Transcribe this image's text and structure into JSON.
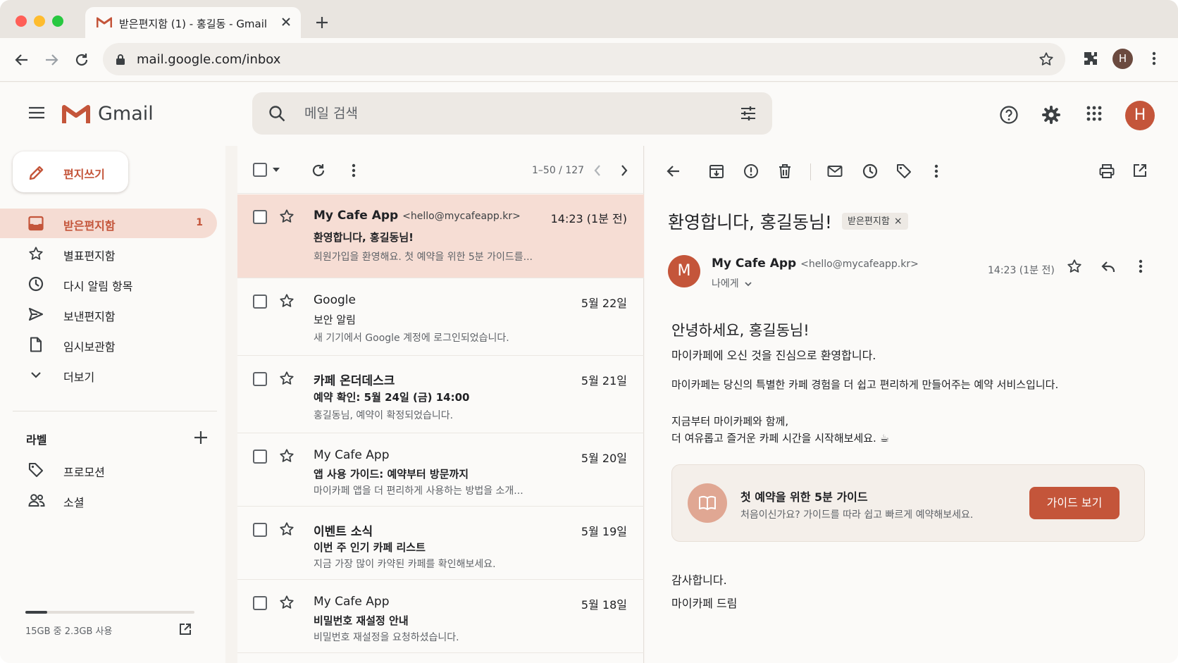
{
  "browser": {
    "tab_title": "받은편지함 (1) - 홍길동 - Gmail",
    "url": "mail.google.com/inbox",
    "profile_initial": "H"
  },
  "header": {
    "brand": "Gmail",
    "search_placeholder": "메일 검색",
    "avatar_initial": "H"
  },
  "sidebar": {
    "compose_label": "편지쓰기",
    "items": [
      {
        "label": "받은편지함",
        "icon": "inbox-icon",
        "count": "1",
        "active": true
      },
      {
        "label": "별표편지함",
        "icon": "star-icon"
      },
      {
        "label": "다시 알림 항목",
        "icon": "clock-icon"
      },
      {
        "label": "보낸편지함",
        "icon": "send-icon"
      },
      {
        "label": "임시보관함",
        "icon": "draft-icon"
      },
      {
        "label": "더보기",
        "icon": "chevron-down-icon"
      }
    ],
    "labels_heading": "라벨",
    "labels": [
      {
        "label": "프로모션",
        "icon": "tag-icon"
      },
      {
        "label": "소셜",
        "icon": "people-icon"
      }
    ],
    "storage_text": "15GB 중 2.3GB 사용",
    "storage_used_fraction": 0.13
  },
  "list": {
    "pager": "1–50 / 127",
    "rows": [
      {
        "from": "My Cafe App",
        "addr": "<hello@mycafeapp.kr>",
        "date": "14:23 (1분 전)",
        "subject": "환영합니다, 홍길동님!",
        "snippet": "회원가입을 환영해요. 첫 예약을 위한 5분 가이드를...",
        "selected": true,
        "unread": true
      },
      {
        "from": "Google",
        "addr": "",
        "date": "5월 22일",
        "subject": "보안 알림",
        "snippet": "새 기기에서 Google 계정에 로그인되었습니다."
      },
      {
        "from": "카페 온더데스크",
        "addr": "",
        "date": "5월 21일",
        "subject": "예약 확인: 5월 24일 (금) 14:00",
        "snippet": "홍길동님, 예약이 확정되었습니다."
      },
      {
        "from": "My Cafe App",
        "addr": "",
        "date": "5월 20일",
        "subject": "앱 사용 가이드: 예약부터 방문까지",
        "snippet": "마이카페 앱을 더 편리하게 사용하는 방법을 소개..."
      },
      {
        "from": "이벤트 소식",
        "addr": "",
        "date": "5월 19일",
        "subject": "이번 주 인기 카페 리스트",
        "snippet": "지금 가장 많이 카약된 카페를 확인해보세요."
      },
      {
        "from": "My Cafe App",
        "addr": "",
        "date": "5월 18일",
        "subject": "비밀번호 재설정 안내",
        "snippet": "비밀번호 재설정을 요청하셨습니다."
      }
    ]
  },
  "reader": {
    "subject": "환영합니다, 홍길동님!",
    "chip": "받은편지함",
    "chip_close": "×",
    "sender_initial": "M",
    "sender_name": "My Cafe App",
    "sender_addr": "<hello@mycafeapp.kr>",
    "to_me": "나에게",
    "time": "14:23 (1분 전)",
    "greeting": "안녕하세요, 홍길동님!",
    "line1": "마이카페에 오신 것을 진심으로 환영합니다.",
    "line2": "마이카페는 당신의 특별한 카페 경험을 더 쉽고 편리하게 만들어주는 예약 서비스입니다.",
    "line3": "지금부터 마이카페와 함께,",
    "line4": "더 여유롭고 즐거운 카페 시간을 시작해보세요. ☕",
    "card_title": "첫 예약을 위한 5분 가이드",
    "card_sub": "처음이신가요? 가이드를 따라 쉽고 빠르게 예약해보세요.",
    "card_button": "가이드 보기",
    "closing": "감사합니다.",
    "signature": "마이카페 드림"
  },
  "colors": {
    "accent": "#c4553a",
    "selected_row": "#f6ddd4",
    "background": "#fbfaf8"
  }
}
